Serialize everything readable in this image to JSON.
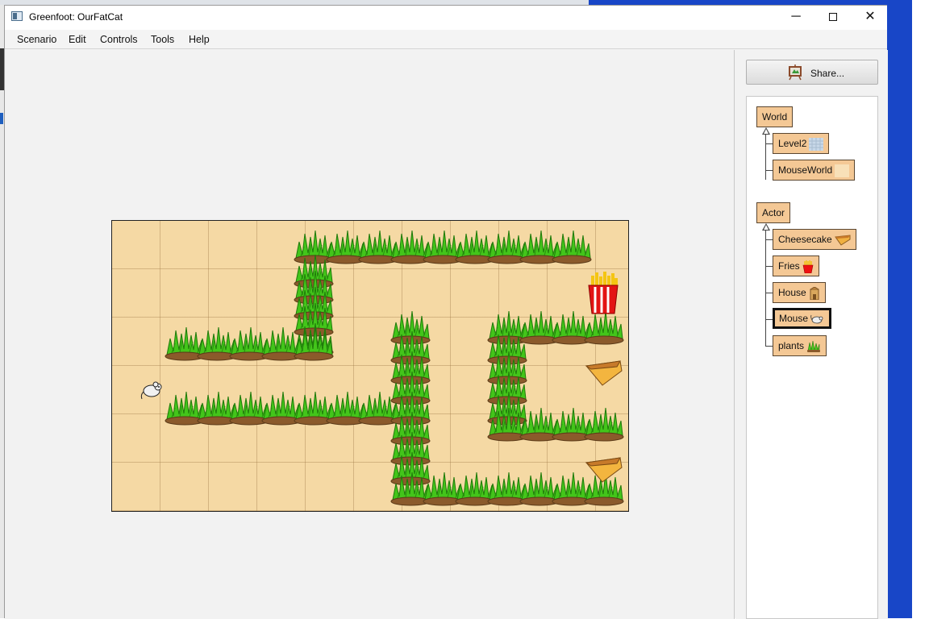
{
  "window": {
    "title": "Greenfoot: OurFatCat",
    "controls": {
      "minimize": "─",
      "close": "✕"
    }
  },
  "menu": [
    "Scenario",
    "Edit",
    "Controls",
    "Tools",
    "Help"
  ],
  "share": {
    "label": "Share..."
  },
  "world_grid": {
    "columns": 10,
    "rows": 6,
    "cells": [
      {
        "type": "plant",
        "col": 0,
        "row": 0,
        "layers": 0
      },
      {
        "type": "plant",
        "col": 3,
        "row": 0,
        "layers": 1
      },
      {
        "type": "plant",
        "col": 4,
        "row": 0,
        "layers": 1
      },
      {
        "type": "plant",
        "col": 5,
        "row": 0,
        "layers": 1
      },
      {
        "type": "plant",
        "col": 6,
        "row": 0,
        "layers": 1
      },
      {
        "type": "plant",
        "col": 7,
        "row": 0,
        "layers": 1
      },
      {
        "type": "plant",
        "col": 8,
        "row": 0,
        "layers": 1
      },
      {
        "type": "plant",
        "col": 9,
        "row": 0,
        "layers": 1
      },
      {
        "type": "plant",
        "col": 10,
        "row": 0,
        "layers": 1
      },
      {
        "type": "plant",
        "col": 11,
        "row": 0,
        "layers": 1
      },
      {
        "type": "plant",
        "col": 3,
        "row": 1,
        "layers": 3
      },
      {
        "type": "plant",
        "col": 3,
        "row": 2,
        "layers": 2
      },
      {
        "type": "plant",
        "col": 0,
        "row": 2,
        "layers": 0
      },
      {
        "type": "plant",
        "col": 1,
        "row": 2,
        "layers": 1
      },
      {
        "type": "plant",
        "col": 2,
        "row": 2,
        "layers": 1
      },
      {
        "type": "plant",
        "col": 3,
        "row": 2,
        "layers": 1
      },
      {
        "type": "plant",
        "col": 4,
        "row": 2,
        "layers": 1
      },
      {
        "type": "plant",
        "col": 6,
        "row": 2,
        "layers": 3
      },
      {
        "type": "plant",
        "col": 8,
        "row": 2,
        "layers": 3
      },
      {
        "type": "plant",
        "col": 9,
        "row": 2,
        "layers": 1
      },
      {
        "type": "plant",
        "col": 10,
        "row": 2,
        "layers": 1
      },
      {
        "type": "plant",
        "col": 11,
        "row": 2,
        "layers": 1
      }
    ]
  },
  "world": {
    "actors": [
      {
        "kind": "plant",
        "col": 3.75,
        "row": 0,
        "stack": 1
      },
      {
        "kind": "plant",
        "col": 4.75,
        "row": 0,
        "stack": 1
      },
      {
        "kind": "plant",
        "col": 5.75,
        "row": 0,
        "stack": 1
      },
      {
        "kind": "plant",
        "col": 6.75,
        "row": 0,
        "stack": 1
      },
      {
        "kind": "plant",
        "col": 7.75,
        "row": 0,
        "stack": 1
      },
      {
        "kind": "plant",
        "col": 8.75,
        "row": 0,
        "stack": 1
      },
      {
        "kind": "plant",
        "col": 9.75,
        "row": 0,
        "stack": 1
      },
      {
        "kind": "plant",
        "col": 10.75,
        "row": 0,
        "stack": 1
      },
      {
        "kind": "plant",
        "col": 11.75,
        "row": 0,
        "stack": 1
      },
      {
        "kind": "plant",
        "col": 3.75,
        "row": 0.65,
        "stack": 1
      },
      {
        "kind": "plant",
        "col": 3.75,
        "row": 1,
        "stack": 1
      },
      {
        "kind": "plant",
        "col": 3.75,
        "row": 1.35,
        "stack": 1
      },
      {
        "kind": "plant",
        "col": 3.75,
        "row": 1.7,
        "stack": 1
      },
      {
        "kind": "plant",
        "col": 1.75,
        "row": 2,
        "stack": 1
      },
      {
        "kind": "plant",
        "col": 2.75,
        "row": 2,
        "stack": 1
      },
      {
        "kind": "plant",
        "col": 3.75,
        "row": 2,
        "stack": 1
      },
      {
        "kind": "plant",
        "col": 4.75,
        "row": 2,
        "stack": 1
      },
      {
        "kind": "plant",
        "col": 5.75,
        "row": 2,
        "stack": 1
      },
      {
        "kind": "fries",
        "col": 10,
        "row": 1
      },
      {
        "kind": "cheesecake",
        "col": 10,
        "row": 3
      },
      {
        "kind": "cheesecake",
        "col": 10,
        "row": 5
      },
      {
        "kind": "mouse",
        "col": 0.75,
        "row": 3.3
      }
    ]
  },
  "classes": {
    "world_root": "World",
    "world_subclasses": [
      "Level2",
      "MouseWorld"
    ],
    "actor_root": "Actor",
    "actor_subclasses": [
      "Cheesecake",
      "Fries",
      "House",
      "Mouse",
      "plants"
    ],
    "selected": "Mouse"
  }
}
